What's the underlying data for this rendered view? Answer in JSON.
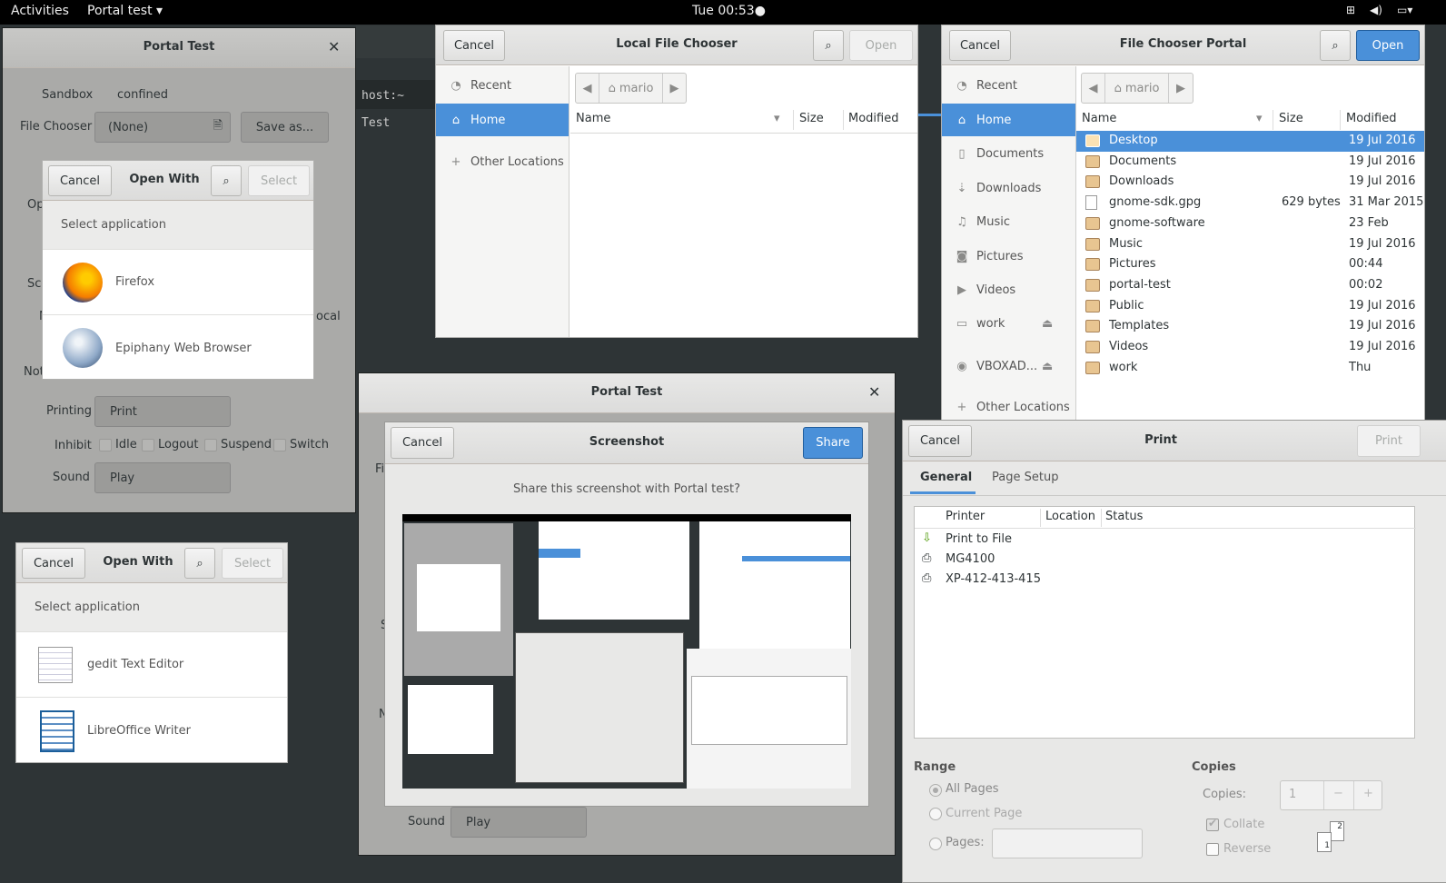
{
  "topbar": {
    "activities": "Activities",
    "app": "Portal test ▾",
    "clock": "Tue 00:53●"
  },
  "portal_main": {
    "title": "Portal Test",
    "sandbox_label": "Sandbox",
    "sandbox_value": "confined",
    "file_chooser_label": "File Chooser",
    "file_chooser_value": "(None)",
    "save_as": "Save as...",
    "open_partial": "Op",
    "screen_partial": "Scr",
    "net_partial": "N",
    "local_partial": "ocal",
    "notif_partial": "Not",
    "printing_label": "Printing",
    "print_btn": "Print",
    "inhibit_label": "Inhibit",
    "inhibit_options": [
      "Idle",
      "Logout",
      "Suspend",
      "Switch"
    ],
    "sound_label": "Sound",
    "play_btn": "Play"
  },
  "terminal": {
    "line1": "host:~",
    "line2": "Test"
  },
  "open_with_1": {
    "cancel": "Cancel",
    "title": "Open With",
    "select": "Select",
    "heading": "Select application",
    "apps": [
      "Firefox",
      "Epiphany Web Browser"
    ]
  },
  "open_with_2": {
    "cancel": "Cancel",
    "title": "Open With",
    "select": "Select",
    "heading": "Select application",
    "apps": [
      "gedit Text Editor",
      "LibreOffice Writer"
    ]
  },
  "local_chooser": {
    "cancel": "Cancel",
    "title": "Local File Chooser",
    "open": "Open",
    "places": [
      "Recent",
      "Home",
      "Other Locations"
    ],
    "crumb": "mario",
    "columns": [
      "Name",
      "Size",
      "Modified"
    ]
  },
  "portal_chooser": {
    "cancel": "Cancel",
    "title": "File Chooser Portal",
    "open": "Open",
    "places": [
      "Recent",
      "Home",
      "Documents",
      "Downloads",
      "Music",
      "Pictures",
      "Videos",
      "work",
      "VBOXAD...",
      "Other Locations"
    ],
    "crumb": "mario",
    "columns": [
      "Name",
      "Size",
      "Modified"
    ],
    "files": [
      {
        "name": "Desktop",
        "size": "",
        "modified": "19 Jul 2016"
      },
      {
        "name": "Documents",
        "size": "",
        "modified": "19 Jul 2016"
      },
      {
        "name": "Downloads",
        "size": "",
        "modified": "19 Jul 2016"
      },
      {
        "name": "gnome-sdk.gpg",
        "size": "629 bytes",
        "modified": "31 Mar 2015"
      },
      {
        "name": "gnome-software",
        "size": "",
        "modified": "23 Feb"
      },
      {
        "name": "Music",
        "size": "",
        "modified": "19 Jul 2016"
      },
      {
        "name": "Pictures",
        "size": "",
        "modified": "00:44"
      },
      {
        "name": "portal-test",
        "size": "",
        "modified": "00:02"
      },
      {
        "name": "Public",
        "size": "",
        "modified": "19 Jul 2016"
      },
      {
        "name": "Templates",
        "size": "",
        "modified": "19 Jul 2016"
      },
      {
        "name": "Videos",
        "size": "",
        "modified": "19 Jul 2016"
      },
      {
        "name": "work",
        "size": "",
        "modified": "Thu"
      }
    ]
  },
  "portal_second": {
    "title": "Portal Test",
    "fi_partial": "Fi",
    "s_partial": "S",
    "n_partial": "N",
    "sound_label": "Sound",
    "play_btn": "Play"
  },
  "screenshot": {
    "cancel": "Cancel",
    "title": "Screenshot",
    "share": "Share",
    "question": "Share this screenshot with Portal test?"
  },
  "print": {
    "cancel": "Cancel",
    "title": "Print",
    "print_btn": "Print",
    "tabs": [
      "General",
      "Page Setup"
    ],
    "columns": [
      "Printer",
      "Location",
      "Status"
    ],
    "printers": [
      "Print to File",
      "MG4100",
      "XP-412-413-415"
    ],
    "range_label": "Range",
    "range_options": [
      "All Pages",
      "Current Page",
      "Pages:"
    ],
    "copies_label": "Copies",
    "copies_field_label": "Copies:",
    "copies_value": "1",
    "minus": "−",
    "plus": "+",
    "collate": "Collate",
    "reverse": "Reverse",
    "page_a": "1",
    "page_b": "2"
  },
  "colors": {
    "accent": "#4a90d9",
    "topbar": "#000000",
    "desktop": "#2e3436"
  }
}
